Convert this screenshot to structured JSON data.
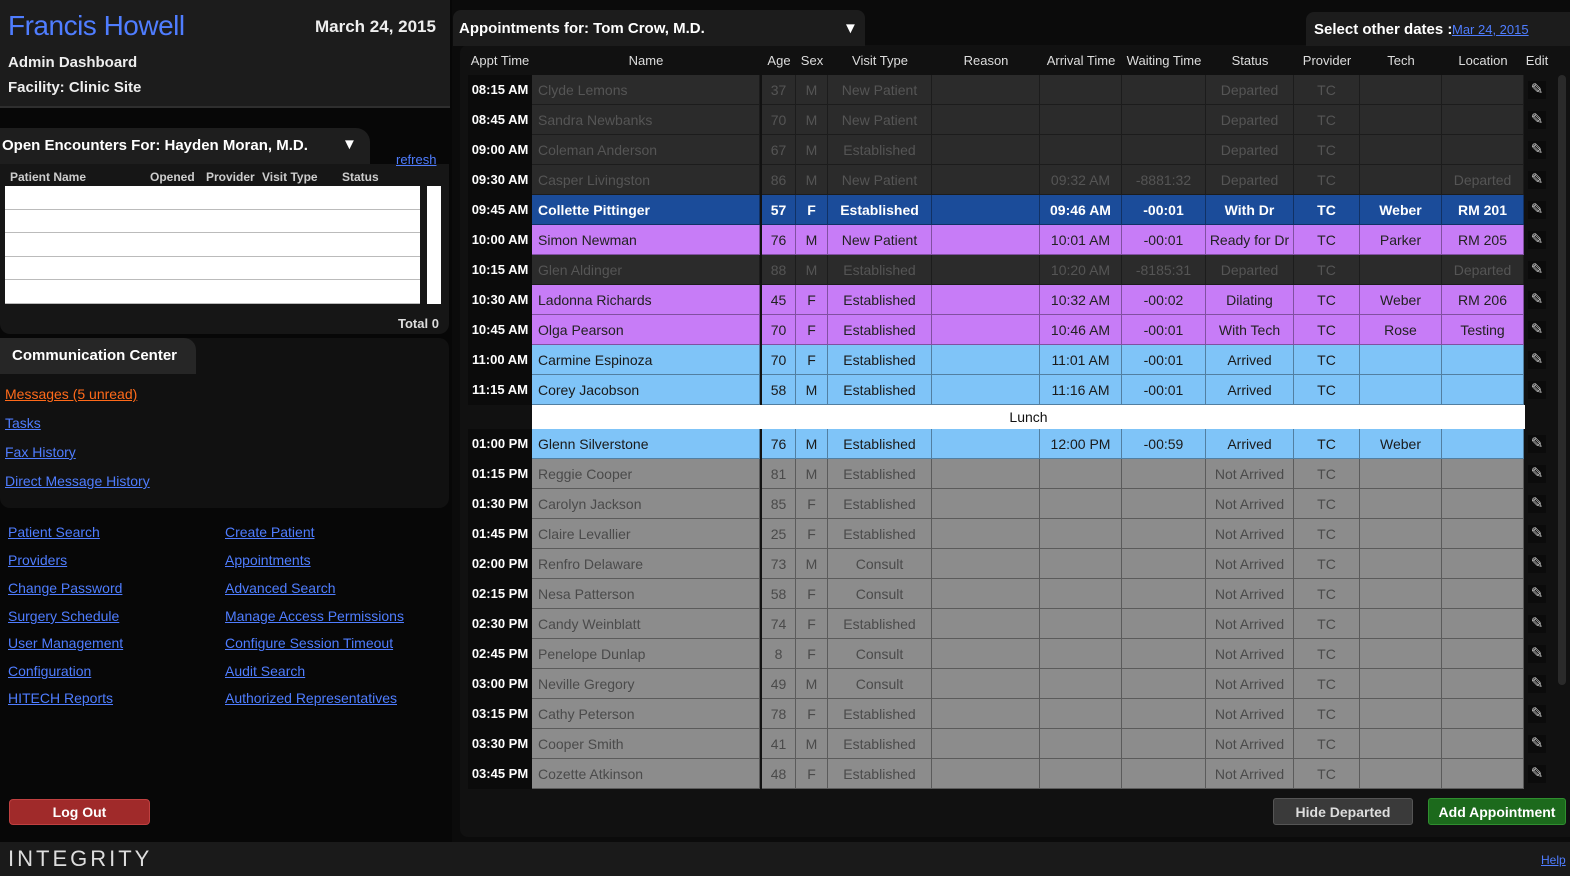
{
  "header": {
    "app_name": "Francis Howell",
    "date": "March 24, 2015",
    "dashboard": "Admin Dashboard",
    "facility": "Facility: Clinic Site"
  },
  "encounters": {
    "label": "Open Encounters For:  Hayden Moran, M.D.",
    "caret": "▼",
    "refresh": "refresh",
    "columns": [
      "Patient Name",
      "Opened",
      "Provider",
      "Visit Type",
      "Status"
    ],
    "total": "Total 0"
  },
  "comm": {
    "title": "Communication Center",
    "messages": "Messages (5 unread)",
    "tasks": "Tasks",
    "fax": "Fax History",
    "direct": "Direct Message History"
  },
  "nav_left": [
    "Patient Search",
    "Providers",
    "Change Password",
    "Surgery Schedule",
    "User Management",
    "Configuration",
    "HITECH Reports"
  ],
  "nav_right": [
    "Create Patient",
    "Appointments",
    "Advanced Search",
    "Manage Access Permissions",
    "Configure Session Timeout",
    "Audit Search",
    "Authorized Representatives"
  ],
  "logout": "Log Out",
  "brand": "INTEGRITY",
  "help": "Help",
  "appointments": {
    "label": "Appointments for:  Tom Crow, M.D.",
    "caret": "▼",
    "date_label": "Select other dates :",
    "date_link": "Mar 24, 2015",
    "columns": [
      "Appt Time",
      "Name",
      "Age",
      "Sex",
      "Visit Type",
      "Reason",
      "Arrival Time",
      "Waiting Time",
      "Status",
      "Provider",
      "Tech",
      "Location",
      "Edit"
    ],
    "rows_am": [
      {
        "time": "08:15 AM",
        "name": "Clyde Lemons",
        "age": "37",
        "sex": "M",
        "visit": "New Patient",
        "reason": "",
        "arrival": "",
        "waiting": "",
        "status": "Departed",
        "provider": "TC",
        "tech": "",
        "location": "",
        "style": "departed"
      },
      {
        "time": "08:45 AM",
        "name": "Sandra Newbanks",
        "age": "70",
        "sex": "M",
        "visit": "New Patient",
        "reason": "",
        "arrival": "",
        "waiting": "",
        "status": "Departed",
        "provider": "TC",
        "tech": "",
        "location": "",
        "style": "departed"
      },
      {
        "time": "09:00 AM",
        "name": "Coleman Anderson",
        "age": "67",
        "sex": "M",
        "visit": "Established",
        "reason": "",
        "arrival": "",
        "waiting": "",
        "status": "Departed",
        "provider": "TC",
        "tech": "",
        "location": "",
        "style": "departed"
      },
      {
        "time": "09:30 AM",
        "name": "Casper Livingston",
        "age": "86",
        "sex": "M",
        "visit": "New Patient",
        "reason": "",
        "arrival": "09:32 AM",
        "waiting": "-8881:32",
        "status": "Departed",
        "provider": "TC",
        "tech": "",
        "location": "Departed",
        "style": "departed"
      },
      {
        "time": "09:45 AM",
        "name": "Collette Pittinger",
        "age": "57",
        "sex": "F",
        "visit": "Established",
        "reason": "",
        "arrival": "09:46 AM",
        "waiting": "-00:01",
        "status": "With Dr",
        "provider": "TC",
        "tech": "Weber",
        "location": "RM 201",
        "style": "selected"
      },
      {
        "time": "10:00 AM",
        "name": "Simon Newman",
        "age": "76",
        "sex": "M",
        "visit": "New Patient",
        "reason": "",
        "arrival": "10:01 AM",
        "waiting": "-00:01",
        "status": "Ready for Dr",
        "provider": "TC",
        "tech": "Parker",
        "location": "RM 205",
        "style": "purple"
      },
      {
        "time": "10:15 AM",
        "name": "Glen Aldinger",
        "age": "88",
        "sex": "M",
        "visit": "Established",
        "reason": "",
        "arrival": "10:20 AM",
        "waiting": "-8185:31",
        "status": "Departed",
        "provider": "TC",
        "tech": "",
        "location": "Departed",
        "style": "departed"
      },
      {
        "time": "10:30 AM",
        "name": "Ladonna Richards",
        "age": "45",
        "sex": "F",
        "visit": "Established",
        "reason": "",
        "arrival": "10:32 AM",
        "waiting": "-00:02",
        "status": "Dilating",
        "provider": "TC",
        "tech": "Weber",
        "location": "RM 206",
        "style": "purple"
      },
      {
        "time": "10:45 AM",
        "name": "Olga Pearson",
        "age": "70",
        "sex": "F",
        "visit": "Established",
        "reason": "",
        "arrival": "10:46 AM",
        "waiting": "-00:01",
        "status": "With Tech",
        "provider": "TC",
        "tech": "Rose",
        "location": "Testing",
        "style": "purple"
      },
      {
        "time": "11:00 AM",
        "name": "Carmine Espinoza",
        "age": "70",
        "sex": "F",
        "visit": "Established",
        "reason": "",
        "arrival": "11:01 AM",
        "waiting": "-00:01",
        "status": "Arrived",
        "provider": "TC",
        "tech": "",
        "location": "",
        "style": "blue"
      },
      {
        "time": "11:15 AM",
        "name": "Corey Jacobson",
        "age": "58",
        "sex": "M",
        "visit": "Established",
        "reason": "",
        "arrival": "11:16 AM",
        "waiting": "-00:01",
        "status": "Arrived",
        "provider": "TC",
        "tech": "",
        "location": "",
        "style": "blue"
      }
    ],
    "lunch": "Lunch",
    "rows_pm": [
      {
        "time": "01:00 PM",
        "name": "Glenn Silverstone",
        "age": "76",
        "sex": "M",
        "visit": "Established",
        "reason": "",
        "arrival": "12:00 PM",
        "waiting": "-00:59",
        "status": "Arrived",
        "provider": "TC",
        "tech": "Weber",
        "location": "",
        "style": "blue"
      },
      {
        "time": "01:15 PM",
        "name": "Reggie Cooper",
        "age": "81",
        "sex": "M",
        "visit": "Established",
        "reason": "",
        "arrival": "",
        "waiting": "",
        "status": "Not Arrived",
        "provider": "TC",
        "tech": "",
        "location": "",
        "style": "grey"
      },
      {
        "time": "01:30 PM",
        "name": "Carolyn Jackson",
        "age": "85",
        "sex": "F",
        "visit": "Established",
        "reason": "",
        "arrival": "",
        "waiting": "",
        "status": "Not Arrived",
        "provider": "TC",
        "tech": "",
        "location": "",
        "style": "grey"
      },
      {
        "time": "01:45 PM",
        "name": "Claire Levallier",
        "age": "25",
        "sex": "F",
        "visit": "Established",
        "reason": "",
        "arrival": "",
        "waiting": "",
        "status": "Not Arrived",
        "provider": "TC",
        "tech": "",
        "location": "",
        "style": "grey"
      },
      {
        "time": "02:00 PM",
        "name": "Renfro Delaware",
        "age": "73",
        "sex": "M",
        "visit": "Consult",
        "reason": "",
        "arrival": "",
        "waiting": "",
        "status": "Not Arrived",
        "provider": "TC",
        "tech": "",
        "location": "",
        "style": "grey"
      },
      {
        "time": "02:15 PM",
        "name": "Nesa Patterson",
        "age": "58",
        "sex": "F",
        "visit": "Consult",
        "reason": "",
        "arrival": "",
        "waiting": "",
        "status": "Not Arrived",
        "provider": "TC",
        "tech": "",
        "location": "",
        "style": "grey"
      },
      {
        "time": "02:30 PM",
        "name": "Candy Weinblatt",
        "age": "74",
        "sex": "F",
        "visit": "Established",
        "reason": "",
        "arrival": "",
        "waiting": "",
        "status": "Not Arrived",
        "provider": "TC",
        "tech": "",
        "location": "",
        "style": "grey"
      },
      {
        "time": "02:45 PM",
        "name": "Penelope Dunlap",
        "age": "8",
        "sex": "F",
        "visit": "Consult",
        "reason": "",
        "arrival": "",
        "waiting": "",
        "status": "Not Arrived",
        "provider": "TC",
        "tech": "",
        "location": "",
        "style": "grey"
      },
      {
        "time": "03:00 PM",
        "name": "Neville Gregory",
        "age": "49",
        "sex": "M",
        "visit": "Consult",
        "reason": "",
        "arrival": "",
        "waiting": "",
        "status": "Not Arrived",
        "provider": "TC",
        "tech": "",
        "location": "",
        "style": "grey"
      },
      {
        "time": "03:15 PM",
        "name": "Cathy Peterson",
        "age": "78",
        "sex": "F",
        "visit": "Established",
        "reason": "",
        "arrival": "",
        "waiting": "",
        "status": "Not Arrived",
        "provider": "TC",
        "tech": "",
        "location": "",
        "style": "grey"
      },
      {
        "time": "03:30 PM",
        "name": "Cooper Smith",
        "age": "41",
        "sex": "M",
        "visit": "Established",
        "reason": "",
        "arrival": "",
        "waiting": "",
        "status": "Not Arrived",
        "provider": "TC",
        "tech": "",
        "location": "",
        "style": "grey"
      },
      {
        "time": "03:45 PM",
        "name": "Cozette Atkinson",
        "age": "48",
        "sex": "F",
        "visit": "Established",
        "reason": "",
        "arrival": "",
        "waiting": "",
        "status": "Not Arrived",
        "provider": "TC",
        "tech": "",
        "location": "",
        "style": "grey"
      }
    ],
    "edit_icon": "pencil-icon",
    "hide_departed": "Hide Departed",
    "add_appointment": "Add Appointment"
  },
  "colors": {
    "link": "#4f7dff",
    "messages": "#ff6a1a",
    "selected_row": "#1b4c9a",
    "purple_row": "#c77cf7",
    "blue_row": "#7fc4f8",
    "grey_row": "#8c8c8c",
    "departed_row": "#2b2b2b",
    "logout": "#a02a2a",
    "add": "#1c6a1c"
  }
}
